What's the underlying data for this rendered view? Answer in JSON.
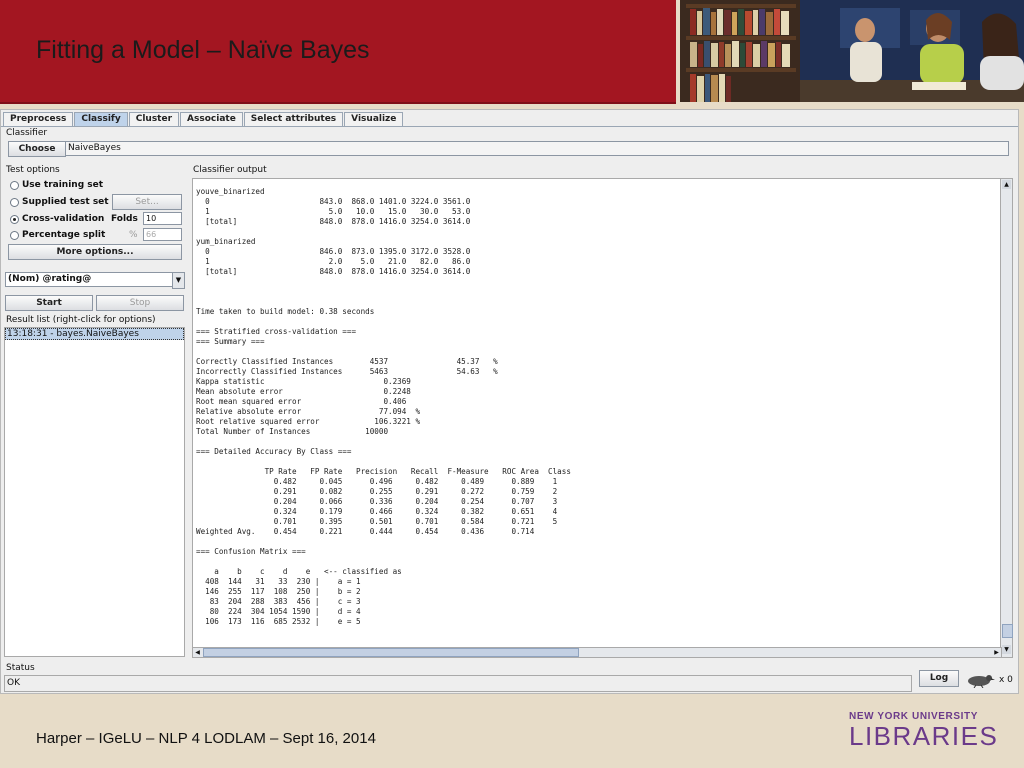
{
  "slide": {
    "title": "Fitting a Model – Naïve Bayes",
    "footer": "Harper – IGeLU – NLP 4 LODLAM – Sept 16, 2014",
    "logo": {
      "top": "NEW YORK UNIVERSITY",
      "main": "LIBRARIES"
    }
  },
  "weka": {
    "tabs": [
      "Preprocess",
      "Classify",
      "Cluster",
      "Associate",
      "Select attributes",
      "Visualize"
    ],
    "active_tab": "Classify",
    "classifier": {
      "label": "Classifier",
      "choose": "Choose",
      "value": "NaiveBayes"
    },
    "test_options": {
      "label": "Test options",
      "use_training": "Use training set",
      "supplied": "Supplied test set",
      "set_button": "Set...",
      "cross_validation": "Cross-validation",
      "folds_label": "Folds",
      "folds_value": "10",
      "percentage": "Percentage split",
      "percent_sign": "%",
      "percent_value": "66",
      "more_options": "More options...",
      "selected": "Cross-validation"
    },
    "class_select": "(Nom) @rating@",
    "start": "Start",
    "stop": "Stop",
    "result_list": {
      "label": "Result list (right-click for options)",
      "items": [
        "13:18:31 - bayes.NaiveBayes"
      ]
    },
    "output_label": "Classifier output",
    "output_text": "youve_binarized\n  0                        843.0  868.0 1401.0 3224.0 3561.0\n  1                          5.0   10.0   15.0   30.0   53.0\n  [total]                  848.0  878.0 1416.0 3254.0 3614.0\n\nyum_binarized\n  0                        846.0  873.0 1395.0 3172.0 3528.0\n  1                          2.0    5.0   21.0   82.0   86.0\n  [total]                  848.0  878.0 1416.0 3254.0 3614.0\n\n\n\nTime taken to build model: 0.38 seconds\n\n=== Stratified cross-validation ===\n=== Summary ===\n\nCorrectly Classified Instances        4537               45.37   %\nIncorrectly Classified Instances      5463               54.63   %\nKappa statistic                          0.2369\nMean absolute error                      0.2248\nRoot mean squared error                  0.406\nRelative absolute error                 77.094  %\nRoot relative squared error            106.3221 %\nTotal Number of Instances            10000\n\n=== Detailed Accuracy By Class ===\n\n               TP Rate   FP Rate   Precision   Recall  F-Measure   ROC Area  Class\n                 0.482     0.045      0.496     0.482     0.489      0.889    1\n                 0.291     0.082      0.255     0.291     0.272      0.759    2\n                 0.204     0.066      0.336     0.204     0.254      0.707    3\n                 0.324     0.179      0.466     0.324     0.382      0.651    4\n                 0.701     0.395      0.501     0.701     0.584      0.721    5\nWeighted Avg.    0.454     0.221      0.444     0.454     0.436      0.714\n\n=== Confusion Matrix ===\n\n    a    b    c    d    e   <-- classified as\n  408  144   31   33  230 |    a = 1\n  146  255  117  108  250 |    b = 2\n   83  204  288  383  456 |    c = 3\n   80  224  304 1054 1590 |    d = 4\n  106  173  116  685 2532 |    e = 5",
    "status": {
      "label": "Status",
      "value": "OK",
      "log": "Log",
      "count": "x 0"
    }
  },
  "colors": {
    "header": "#a31621",
    "background": "#e7dcc8",
    "logo": "#6b3a8a",
    "tab_active": "#bfd3ea"
  }
}
